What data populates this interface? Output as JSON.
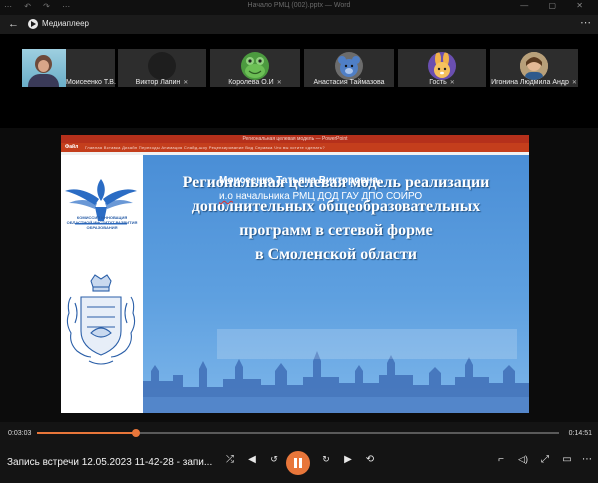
{
  "window": {
    "quick_access": "⋯ ↶ ↷ ⋯",
    "doc_title": "Начало РМЦ (002).pptx — Word",
    "controls": "— ▢ ✕"
  },
  "app": {
    "back_glyph": "←",
    "name": "Медиаплеер",
    "more_glyph": "⋯"
  },
  "participants": [
    {
      "name": "Моисеенко Т.В.",
      "mic": "",
      "avatar": "video"
    },
    {
      "name": "Виктор Лапин",
      "mic": "✕",
      "avatar": "dark"
    },
    {
      "name": "Королева О.И",
      "mic": "✕",
      "avatar": "frog"
    },
    {
      "name": "Анастасия Таймазова",
      "mic": "",
      "avatar": "bear"
    },
    {
      "name": "Гость",
      "mic": "✕",
      "avatar": "bunny"
    },
    {
      "name": "Игонина Людмила Андр",
      "mic": "✕",
      "avatar": "photo"
    }
  ],
  "powerpoint": {
    "title": "Региональная целевая модель — PowerPoint",
    "file_tab": "Файл",
    "tabs": "Главная   Вставка   Дизайн   Переходы   Анимация   Слайд-шоу   Рецензирование   Вид   Справка   Что вы хотите сделать?"
  },
  "slide": {
    "logo_caption": "КОМИССИЯ ИННОВАЦИЯ ОБЛАСТНОЙ ИНСТИТУТ РАЗВИТИЯ ОБРАЗОВАНИЯ",
    "title_lines": [
      "Региональная целевая модель реализации",
      "дополнительных общеобразовательных",
      "программ в сетевой форме",
      "в Смоленской области"
    ],
    "author_name": "Моисеенко Татьяна Викторовна,",
    "author_role_prefix": "и.о",
    "author_role": " начальника РМЦ ДОД ГАУ ДПО СОИРО"
  },
  "player": {
    "time_current": "0:03:03",
    "time_total": "0:14:51",
    "progress": 0.19,
    "recording_title": "Запись встречи 12.05.2023 11-42-28 - запи...",
    "accent": "#e8763a"
  }
}
